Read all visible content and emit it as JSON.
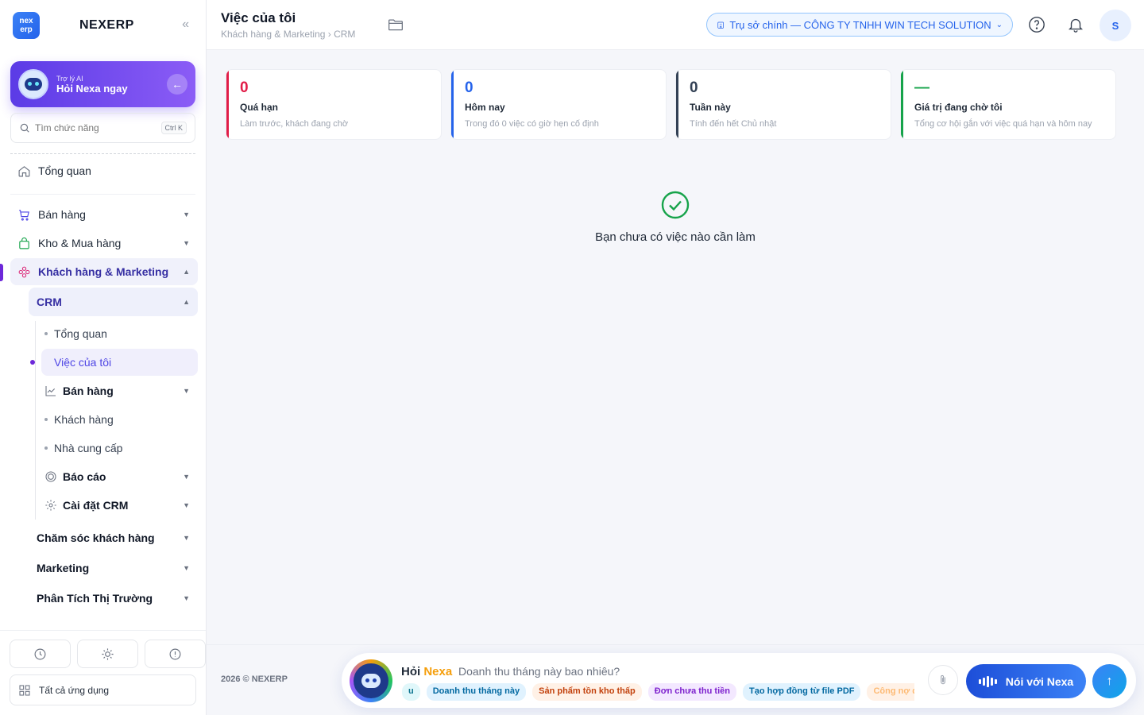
{
  "brand": {
    "logo_top": "nex",
    "logo_bottom": "erp",
    "name": "NEXERP"
  },
  "ai_card": {
    "small": "Trợ lý AI",
    "big": "Hỏi Nexa ngay"
  },
  "search": {
    "placeholder": "Tìm chức năng",
    "shortcut": "Ctrl K"
  },
  "nav": {
    "overview": "Tổng quan",
    "sales": "Bán hàng",
    "warehouse": "Kho & Mua hàng",
    "customers": "Khách hàng & Marketing",
    "crm": "CRM",
    "crm_items": {
      "overview": "Tổng quan",
      "my_tasks": "Việc của tôi",
      "sales": "Bán hàng",
      "customers": "Khách hàng",
      "suppliers": "Nhà cung cấp",
      "reports": "Báo cáo",
      "settings": "Cài đặt CRM"
    },
    "care": "Chăm sóc khách hàng",
    "marketing": "Marketing",
    "market_analysis": "Phân Tích Thị Trường",
    "all_apps": "Tất cả ứng dụng"
  },
  "header": {
    "title": "Việc của tôi",
    "breadcrumb": "Khách hàng & Marketing › CRM",
    "branch": "Trụ sở chính — CÔNG TY TNHH WIN TECH SOLUTION",
    "avatar": "S"
  },
  "cards": [
    {
      "value": "0",
      "label": "Quá hạn",
      "desc": "Làm trước, khách đang chờ",
      "color": "#e11d48"
    },
    {
      "value": "0",
      "label": "Hôm nay",
      "desc": "Trong đó 0 việc có giờ hẹn cố định",
      "color": "#2563eb"
    },
    {
      "value": "0",
      "label": "Tuần này",
      "desc": "Tính đến hết Chủ nhật",
      "color": "#334155"
    },
    {
      "value": "—",
      "label": "Giá trị đang chờ tôi",
      "desc": "Tổng cơ hội gắn với việc quá hạn và hôm nay",
      "color": "#16a34a"
    }
  ],
  "empty": {
    "text": "Bạn chưa có việc nào cần làm"
  },
  "footer": {
    "copyright": "2026 © NEXERP",
    "ask_prefix": "Hỏi ",
    "ask_name": "Nexa",
    "placeholder": "Doanh thu tháng này bao nhiêu?",
    "chips": [
      {
        "label": "u",
        "bg": "#e0f7fa",
        "fg": "#0e7490"
      },
      {
        "label": "Doanh thu tháng này",
        "bg": "#e0f2fe",
        "fg": "#0369a1"
      },
      {
        "label": "Sản phẩm tồn kho thấp",
        "bg": "#fff1e6",
        "fg": "#c2410c"
      },
      {
        "label": "Đơn chưa thu tiền",
        "bg": "#f3e8ff",
        "fg": "#7e22ce"
      },
      {
        "label": "Tạo hợp đồng từ file PDF",
        "bg": "#e0f2fe",
        "fg": "#0369a1"
      },
      {
        "label": "Công nợ q",
        "bg": "#fff1e6",
        "fg": "#fdba74"
      }
    ],
    "voice_label": "Nói với Nexa"
  }
}
